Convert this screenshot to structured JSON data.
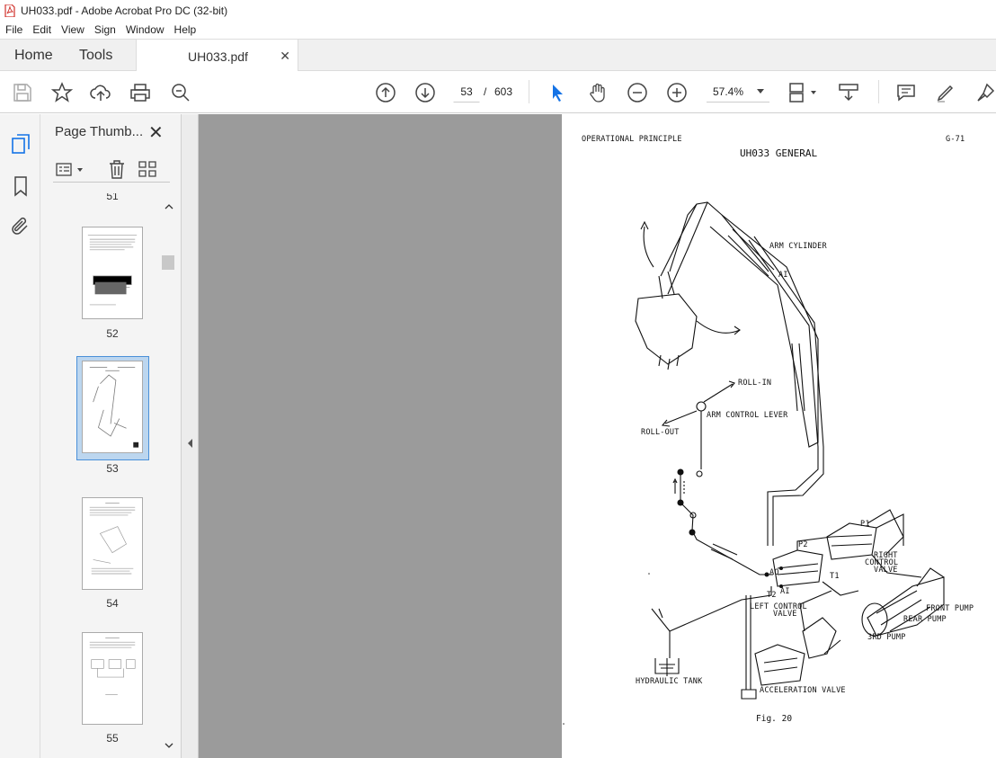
{
  "window": {
    "title": "UH033.pdf - Adobe Acrobat Pro DC (32-bit)"
  },
  "menu": {
    "items": [
      "File",
      "Edit",
      "View",
      "Sign",
      "Window",
      "Help"
    ]
  },
  "tabs": {
    "home": "Home",
    "tools": "Tools",
    "document": "UH033.pdf"
  },
  "toolbar": {
    "current_page": "53",
    "page_separator": "/",
    "total_pages": "603",
    "zoom": "57.4%"
  },
  "thumbnails": {
    "panel_title": "Page Thumb...",
    "top_partial_label": "51",
    "pages": [
      {
        "label": "52",
        "selected": false
      },
      {
        "label": "53",
        "selected": true
      },
      {
        "label": "54",
        "selected": false
      },
      {
        "label": "55",
        "selected": false
      }
    ]
  },
  "document_page": {
    "header_left": "OPERATIONAL PRINCIPLE",
    "header_right": "G-71",
    "title": "UH033 GENERAL",
    "labels": {
      "arm_cylinder": "ARM CYLINDER",
      "ai": "AI",
      "roll_in": "ROLL-IN",
      "arm_control_lever": "ARM CONTROL LEVER",
      "roll_out": "ROLL-OUT",
      "p1": "P1",
      "p2": "P2",
      "t1": "T1",
      "right_control_valve_1": "RIGHT",
      "right_control_valve_2": "CONTROL",
      "right_control_valve_3": "VALVE",
      "ao": "AO",
      "t2": "T2",
      "ai2": "AI",
      "left_control_valve_1": "LEFT CONTROL",
      "left_control_valve_2": "VALVE",
      "front_pump": "FRONT PUMP",
      "rear_pump": "REAR PUMP",
      "third_pump": "3RD PUMP",
      "hydraulic_tank": "HYDRAULIC TANK",
      "acceleration_valve": "ACCELERATION VALVE",
      "fig": "Fig. 20"
    }
  },
  "colors": {
    "accent_blue": "#1473e6",
    "viewer_gray": "#9b9b9b",
    "selected_thumb_bg": "#bcd6ef"
  }
}
